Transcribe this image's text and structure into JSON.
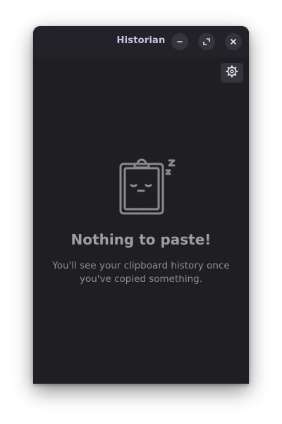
{
  "window": {
    "title": "Historian",
    "buttons": {
      "minimize_icon": "minimize-icon",
      "maximize_icon": "maximize-icon",
      "close_icon": "close-icon"
    }
  },
  "toolbar": {
    "settings_icon": "gear-icon"
  },
  "empty_state": {
    "icon": "sleeping-clipboard-icon",
    "title": "Nothing to paste!",
    "description": "You'll see your clipboard history once you've copied something."
  },
  "colors": {
    "window_bg": "#1f1e23",
    "titlebar_bg": "#232228",
    "title_text": "#cfc3e6",
    "button_bg": "#35343a",
    "muted_text": "#9f9e9e"
  }
}
